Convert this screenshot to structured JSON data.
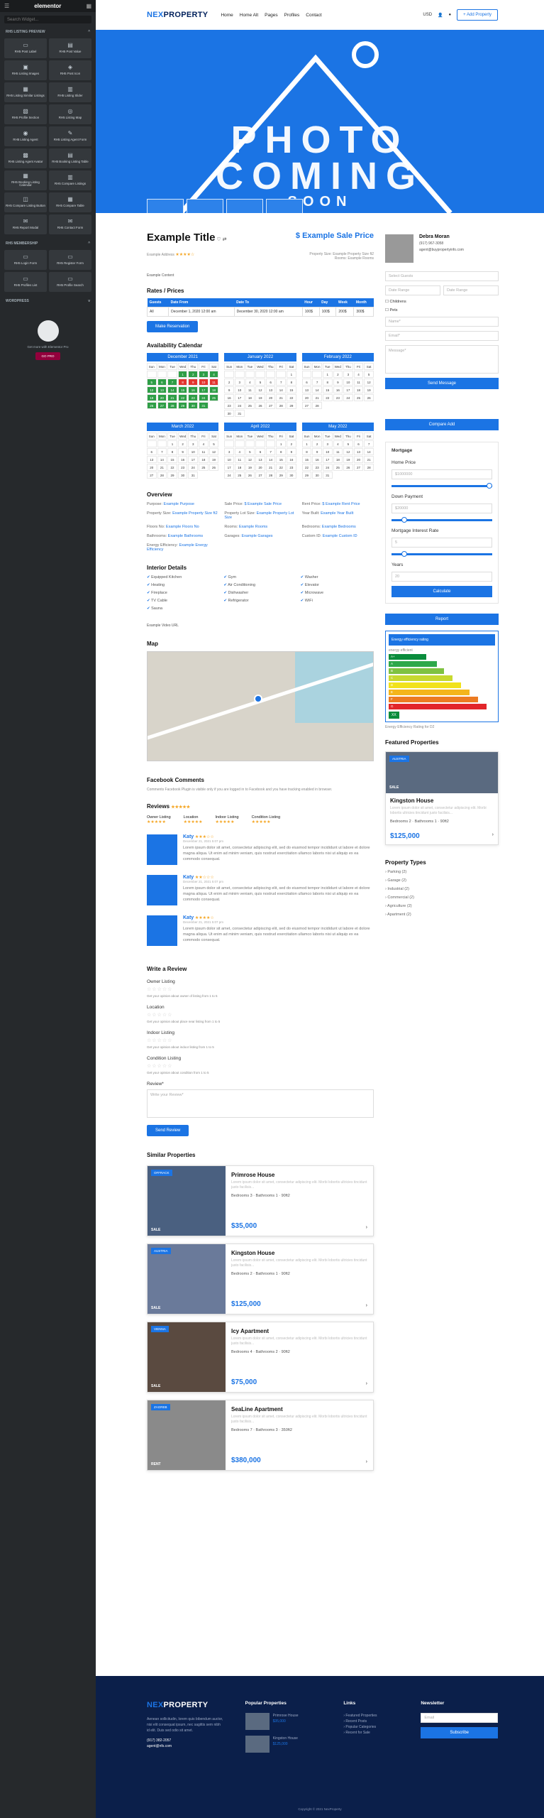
{
  "editor": {
    "logo": "elementor",
    "search_placeholder": "Search Widget...",
    "section_listing": "RH5 LISTING PREVIEW",
    "widgets": [
      "RH5 Post Label",
      "RH5 Post Value",
      "RH5 Listing Images",
      "RH5 Post Icon",
      "RH5 Listing Similar Listings",
      "RH5 Listing Slider",
      "RH5 Profile Section",
      "RH5 Listing Map",
      "RH5 Listing Agent",
      "RH5 Listing Agent Form",
      "RH5 Listing Agent Avatar",
      "RH5 Booking Listing Table",
      "RH5 Booking Listing Calendar",
      "RH5 Compare Listings",
      "RH5 Compare Listing Button",
      "RH5 Compare Table",
      "RH5 Report Modal",
      "RH5 Contact Form"
    ],
    "section_membership": "RH5 MEMBERSHIP",
    "membership_widgets": [
      "RH5 Login Form",
      "RH5 Register Form",
      "RH5 Profiles List",
      "RH5 Profile Search"
    ],
    "section_wp": "WORDPRESS",
    "promo_text": "Get more with Elementor Pro",
    "promo_button": "GO PRO"
  },
  "header": {
    "logo_prefix": "NEX",
    "logo_suffix": "PROPERTY",
    "nav": [
      "Home",
      "Home Alt",
      "Pages",
      "Profiles",
      "Contact"
    ],
    "currency": "USD",
    "add_button": "+ Add Property"
  },
  "hero": {
    "line1": "PHOTO",
    "line2": "COMING",
    "line3": "SOON"
  },
  "listing": {
    "title": "Example Title",
    "price": "$ Example Sale Price",
    "meta_left": "Example Address",
    "meta_right": "Property Size: Example Property Size ft2",
    "meta_right2": "Rooms: Example Rooms",
    "content": "Example Content",
    "rates_title": "Rates / Prices",
    "rates_headers": [
      "Guests",
      "Date From",
      "Date To",
      "Hour",
      "Day",
      "Week",
      "Month"
    ],
    "rates_row": [
      "All",
      "December 1, 2020 12:00 am",
      "December 30, 2020 12:00 am",
      "100$",
      "100$",
      "200$",
      "300$"
    ],
    "reservation_button": "Make Reservation",
    "calendar_title": "Availability Calendar",
    "months": [
      "December 2021",
      "January 2022",
      "February 2022",
      "March 2022",
      "April 2022",
      "May 2022"
    ],
    "weekdays": [
      "Sun",
      "Mon",
      "Tue",
      "Wed",
      "Thu",
      "Fri",
      "Sat"
    ],
    "overview_title": "Overview",
    "overview": [
      {
        "label": "Purpose:",
        "value": "Example Purpose"
      },
      {
        "label": "Sale Price:",
        "value": "$ Example Sale Price"
      },
      {
        "label": "Rent Price:",
        "value": "$ Example Rent Price"
      },
      {
        "label": "Property Size:",
        "value": "Example Property Size ft2"
      },
      {
        "label": "Property Lot Size:",
        "value": "Example Property Lot Size"
      },
      {
        "label": "Year Built:",
        "value": "Example Year Built"
      },
      {
        "label": "Floors No:",
        "value": "Example Floors No"
      },
      {
        "label": "Rooms:",
        "value": "Example Rooms"
      },
      {
        "label": "Bedrooms:",
        "value": "Example Bedrooms"
      },
      {
        "label": "Bathrooms:",
        "value": "Example Bathrooms"
      },
      {
        "label": "Garages:",
        "value": "Example Garages"
      },
      {
        "label": "Custom ID:",
        "value": "Example Custom ID"
      },
      {
        "label": "Energy Efficiency:",
        "value": "Example Energy Efficiency"
      }
    ],
    "interior_title": "Interior Details",
    "interior": [
      "Equipped Kitchen",
      "Gym",
      "Washer",
      "Heating",
      "Air Conditioning",
      "Elevator",
      "Fireplace",
      "Dishwasher",
      "Microwave",
      "TV Cable",
      "Refrigerator",
      "WiFi",
      "Sauna"
    ],
    "video": "Example Video URL",
    "map_title": "Map",
    "fb_title": "Facebook Comments",
    "fb_text": "Comments Facebook Plugin is visible only if you are logged in to Facebook and you have tracking enabled in browser.",
    "reviews_title": "Reviews",
    "rating_cats": [
      "Owner Listing",
      "Location",
      "Indoor Listing",
      "Condition Listing"
    ],
    "reviews": [
      {
        "name": "Katy",
        "date": "December 21, 2021 5:07 pm",
        "text": "Lorem ipsum dolor sit amet, consectetur adipiscing elit, sed do eiusmod tempor incididunt ut labore et dolore magna aliqua. Ut enim ad minim veniam, quis nostrud exercitation ullamco laboris nisi ut aliquip ex ea commodo consequat."
      },
      {
        "name": "Katy",
        "date": "December 21, 2021 5:07 pm",
        "text": "Lorem ipsum dolor sit amet, consectetur adipiscing elit, sed do eiusmod tempor incididunt ut labore et dolore magna aliqua. Ut enim ad minim veniam, quis nostrud exercitation ullamco laboris nisi ut aliquip ex ea commodo consequat."
      },
      {
        "name": "Katy",
        "date": "December 21, 2021 5:07 pm",
        "text": "Lorem ipsum dolor sit amet, consectetur adipiscing elit, sed do eiusmod tempor incididunt ut labore et dolore magna aliqua. Ut enim ad minim veniam, quis nostrud exercitation ullamco laboris nisi ut aliquip ex ea commodo consequat."
      }
    ],
    "write_title": "Write a Review",
    "write_fields": [
      {
        "label": "Owner Listing",
        "help": "Get your opinion about owner of listing from 1 to 5"
      },
      {
        "label": "Location",
        "help": "Get your opinion about place near listing from 1 to 5"
      },
      {
        "label": "Indoor Listing",
        "help": "Get your opinion about indoor listing from 1 to 5"
      },
      {
        "label": "Condition Listing",
        "help": "Get your opinion about condition from 1 to 5"
      }
    ],
    "review_label": "Review*",
    "review_placeholder": "Write your Review*",
    "send_review": "Send Review",
    "similar_title": "Similar Properties",
    "similar": [
      {
        "badge": "OFFRACK",
        "sale": "SALE",
        "title": "Primrose House",
        "desc": "Lorem ipsum dolor sit amet, consectetur adipiscing elit. Morbi lobortis ultricies tincidunt justo facilisis...",
        "meta": "Bedrooms 3 · Bathrooms 1 · 90ft2",
        "price": "$35,000"
      },
      {
        "badge": "AUSTRIA",
        "sale": "SALE",
        "title": "Kingston House",
        "desc": "Lorem ipsum dolor sit amet, consectetur adipiscing elit. Morbi lobortis ultricies tincidunt justo facilisis...",
        "meta": "Bedrooms 2 · Bathrooms 1 · 90ft2",
        "price": "$125,000"
      },
      {
        "badge": "VIENNA",
        "sale": "SALE",
        "title": "Icy Apartment",
        "desc": "Lorem ipsum dolor sit amet, consectetur adipiscing elit. Morbi lobortis ultricies tincidunt justo facilisis...",
        "meta": "Bedrooms 4 · Bathrooms 2 · 90ft2",
        "price": "$75,000"
      },
      {
        "badge": "ZAGREB",
        "sale": "RENT",
        "title": "SeaLine Apartment",
        "desc": "Lorem ipsum dolor sit amet, consectetur adipiscing elit. Morbi lobortis ultricies tincidunt justo facilisis...",
        "meta": "Bedrooms 7 · Bathrooms 3 · 350ft2",
        "price": "$380,000"
      }
    ]
  },
  "sidebar": {
    "agent_name": "Debra Moran",
    "agent_phone": "(917) 967-3058",
    "agent_email": "agent@buypropertyinfo.com",
    "select_guests": "Select Guests",
    "date_range": "Date Range",
    "date_range2": "Date Range",
    "children": "Childrens",
    "pets": "Pets",
    "name_ph": "Name*",
    "email_ph": "Email*",
    "message_ph": "Message*",
    "send_message": "Send Message",
    "compare": "Compare Add",
    "mortgage_title": "Mortgage",
    "home_price_label": "Home Price",
    "home_price": "1000000",
    "down_label": "Down Payment",
    "down": "20000",
    "rate_label": "Mortgage Interest Rate",
    "rate": "5",
    "years_label": "Years",
    "years": "20",
    "calculate": "Calculate",
    "report": "Report",
    "energy_title": "Energy efficiency rating",
    "energy_top": "energy efficient",
    "energy_levels": [
      "A+",
      "A",
      "B",
      "C",
      "D",
      "E",
      "F",
      "G"
    ],
    "energy_colors": [
      "#0a8c3c",
      "#2ea84a",
      "#7fc241",
      "#c7d92f",
      "#f1e21a",
      "#f4b51c",
      "#ec7b22",
      "#e2252a"
    ],
    "energy_fill": [
      0.35,
      0.45,
      0.52,
      0.6,
      0.68,
      0.76,
      0.84,
      0.92
    ],
    "energy_marker": "XX",
    "energy_caption": "Energy Efficiency Rating for D2",
    "featured_title": "Featured Properties",
    "featured": {
      "badge": "AUSTRIA",
      "sale": "SALE",
      "title": "Kingston House",
      "desc": "Lorem ipsum dolor sit amet, consectetur adipiscing elit. Morbi lobortis ultricies tincidunt justo facilisis...",
      "meta": "Bedrooms 2 · Bathrooms 1 · 90ft2",
      "price": "$125,000"
    },
    "types_title": "Property Types",
    "types": [
      "Parking (2)",
      "Garage (2)",
      "Industrial (2)",
      "Commercial (2)",
      "Agriculture (2)",
      "Apartment (2)"
    ]
  },
  "footer": {
    "logo_prefix": "NEX",
    "logo_suffix": "PROPERTY",
    "about": "Aenean sollicitudin, lorem quis bibendum auctor, nisi elit consequat ipsum, nec sagittis sem nibh id elit. Duis sed odio sit amet.",
    "phone": "(917) 382-2057",
    "email": "agent@nfs.com",
    "popular_title": "Popular Properties",
    "popular": [
      {
        "title": "Primrose House",
        "price": "$35,000"
      },
      {
        "title": "Kingston House",
        "price": "$125,000"
      }
    ],
    "links_title": "Links",
    "links": [
      "Featured Properties",
      "Recent Posts",
      "Popular Categories",
      "Recent for Sale"
    ],
    "newsletter_title": "Newsletter",
    "email_ph": "Email",
    "subscribe": "Subscribe",
    "copyright": "Copyright © 2021 NexProperty"
  }
}
